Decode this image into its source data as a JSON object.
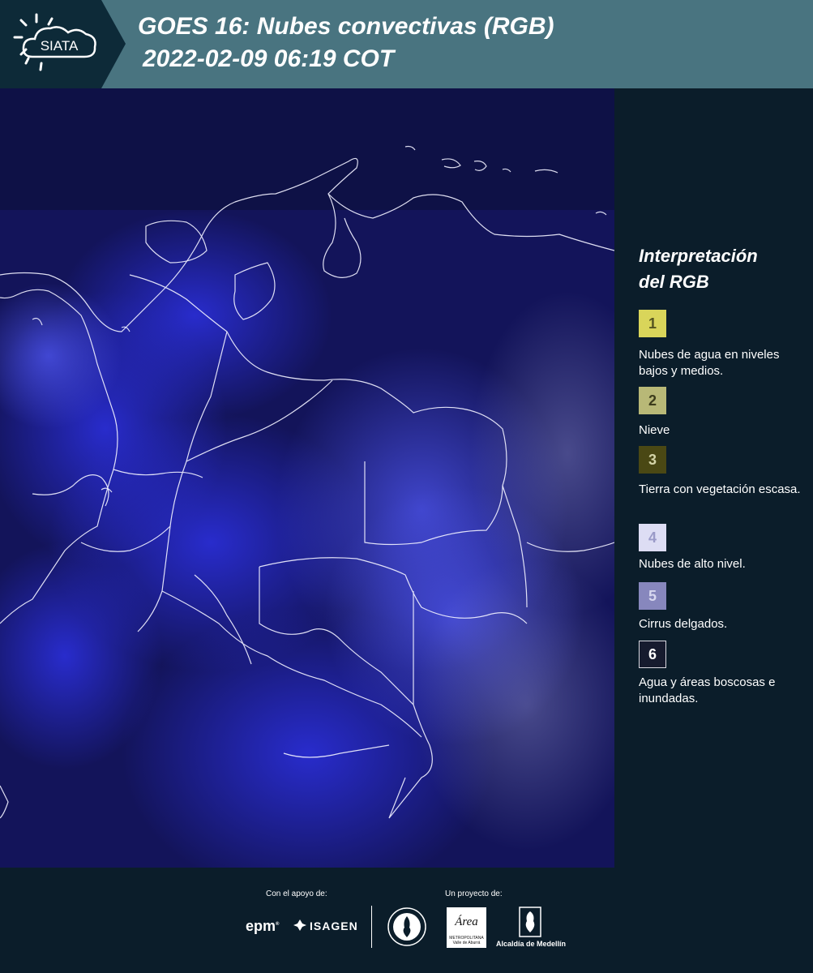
{
  "header": {
    "logo_text": "SIATA",
    "title_line1": "GOES 16: Nubes convectivas (RGB)",
    "title_line2": "2022-02-09 06:19 COT",
    "background_color": "#497480"
  },
  "map": {
    "icon": "satellite-image",
    "background_color": "#13145a"
  },
  "legend": {
    "title_line1": "Interpretación",
    "title_line2": "del RGB",
    "items": [
      {
        "number": "1",
        "label": "Nubes de agua en niveles bajos y medios.",
        "color": "#d9d55a"
      },
      {
        "number": "2",
        "label": "Nieve",
        "color": "#b8b877"
      },
      {
        "number": "3",
        "label": "Tierra con vegetación escasa.",
        "color": "#4a4814"
      },
      {
        "number": "4",
        "label": "Nubes de alto nivel.",
        "color": "#ddddf4"
      },
      {
        "number": "5",
        "label": "Cirrus delgados.",
        "color": "#8787bd"
      },
      {
        "number": "6",
        "label": "Agua y áreas boscosas e inundadas.",
        "color": "#161b2e"
      }
    ]
  },
  "footer": {
    "support_label": "Con el apoyo de:",
    "project_label": "Un proyecto de:",
    "sponsors": [
      "epm",
      "ISAGEN"
    ],
    "partners": {
      "amva_word": "Área",
      "amva_sub": "METROPOLITANA Valle de Aburrá",
      "alcaldia": "Alcaldía de Medellín"
    }
  }
}
